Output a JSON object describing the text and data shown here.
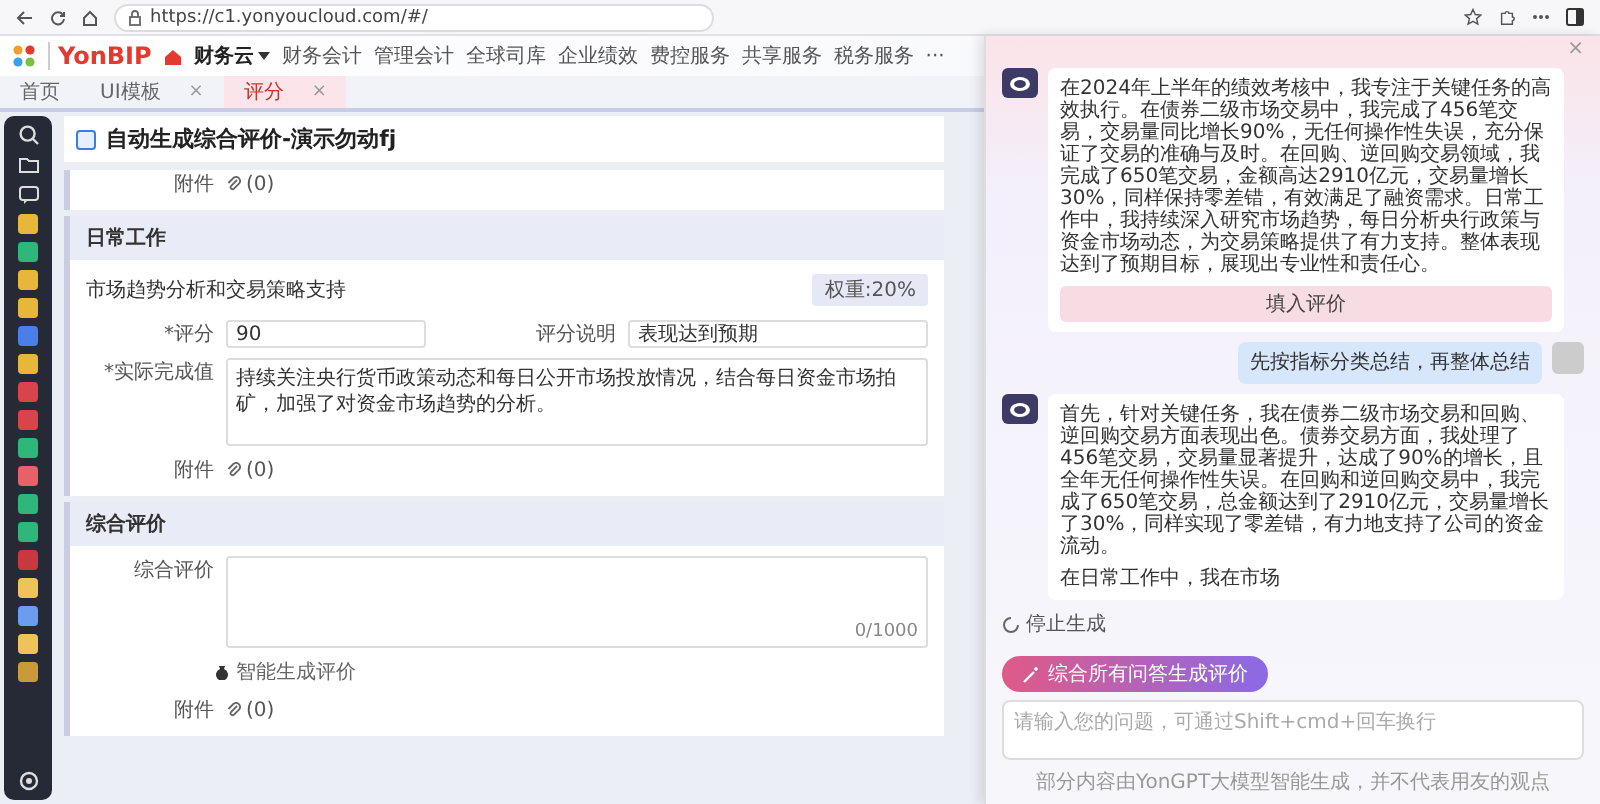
{
  "browser": {
    "url": "https://c1.yonyoucloud.com/#/"
  },
  "nav": {
    "brand": "YonBIP",
    "items": [
      {
        "label": "财务云",
        "selected": true,
        "dropdown": true
      },
      {
        "label": "财务会计",
        "selected": false,
        "dropdown": false
      },
      {
        "label": "管理会计",
        "selected": false,
        "dropdown": false
      },
      {
        "label": "全球司库",
        "selected": false,
        "dropdown": false
      },
      {
        "label": "企业绩效",
        "selected": false,
        "dropdown": false
      },
      {
        "label": "费控服务",
        "selected": false,
        "dropdown": false
      },
      {
        "label": "共享服务",
        "selected": false,
        "dropdown": false
      },
      {
        "label": "税务服务",
        "selected": false,
        "dropdown": false
      }
    ],
    "more": "···"
  },
  "tabs": [
    {
      "label": "首页",
      "selected": false
    },
    {
      "label": "UI模板",
      "close": "×",
      "selected": false
    },
    {
      "label": "评分",
      "close": "×",
      "selected": true
    }
  ],
  "page": {
    "title": "自动生成综合评价-演示勿动fj",
    "top_attachment": {
      "label": "附件",
      "value": "(0)"
    },
    "daily_work": {
      "heading": "日常工作",
      "item_title": "市场趋势分析和交易策略支持",
      "weight": "权重:20%",
      "score": {
        "label": "*评分",
        "value": "90"
      },
      "score_note": {
        "label": "评分说明",
        "value": "表现达到预期"
      },
      "actual": {
        "label": "*实际完成值",
        "value": "持续关注央行货币政策动态和每日公开市场投放情况，结合每日资金市场拍矿，加强了对资金市场趋势的分析。"
      },
      "attachment": {
        "label": "附件",
        "value": "(0)"
      }
    },
    "overall": {
      "heading": "综合评价",
      "field": {
        "label": "综合评价",
        "counter": "0/1000"
      },
      "generate_link": "智能生成评价",
      "attachment": {
        "label": "附件",
        "value": "(0)"
      }
    }
  },
  "assistant": {
    "close": "×",
    "messages": [
      {
        "kind": "assistant",
        "paragraphs": [
          "在2024年上半年的绩效考核中，我专注于关键任务的高效执行。在债券二级市场交易中，我完成了456笔交易，交易量同比增长90%，无任何操作性失误，充分保证了交易的准确与及时。在回购、逆回购交易领域，我完成了650笔交易，金额高达2910亿元，交易量增长30%，同样保持零差错，有效满足了融资需求。日常工作中，我持续深入研究市场趋势，每日分析央行政策与资金市场动态，为交易策略提供了有力支持。整体表现达到了预期目标，展现出专业性和责任心。"
        ],
        "action": "填入评价"
      },
      {
        "kind": "user",
        "paragraphs": [
          "先按指标分类总结，再整体总结"
        ]
      },
      {
        "kind": "assistant",
        "paragraphs": [
          "首先，针对关键任务，我在债券二级市场交易和回购、逆回购交易方面表现出色。债券交易方面，我处理了456笔交易，交易量显著提升，达成了90%的增长，且全年无任何操作性失误。在回购和逆回购交易中，我完成了650笔交易，总金额达到了2910亿元，交易量增长了30%，同样实现了零差错，有力地支持了公司的资金流动。",
          "在日常工作中，我在市场"
        ]
      }
    ],
    "stop": "停止生成",
    "generate_button": "综合所有问答生成评价",
    "input": {
      "placeholder": "请输入您的问题，可通过Shift+cmd+回车换行"
    },
    "footer": "部分内容由YonGPT大模型智能生成，并不代表用友的观点"
  }
}
